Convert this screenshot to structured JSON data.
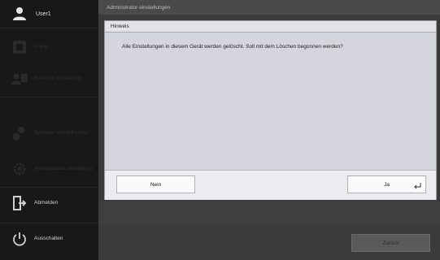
{
  "user": {
    "name": "User1",
    "icon": "user-icon"
  },
  "sidebar": {
    "items": [
      {
        "label": "Kopie",
        "icon": "copy-icon",
        "state": "disabled"
      },
      {
        "label": "Einfache Einstellung",
        "icon": "user-settings-icon",
        "state": "disabled"
      },
      {
        "label": "Benutzer-einstellungen",
        "icon": "user-gear-icon",
        "state": "disabled"
      },
      {
        "label": "Administrator einstellung",
        "icon": "gear-icon",
        "state": "disabled"
      },
      {
        "label": "Abmelden",
        "icon": "logout-icon",
        "state": "active"
      },
      {
        "label": "Ausschalten",
        "icon": "power-icon",
        "state": "active"
      }
    ]
  },
  "main": {
    "title": "Administrator einstellungen",
    "back_label": "Zurück"
  },
  "dialog": {
    "title": "Hinweis",
    "message": "Alle Einstellungen in diesem Gerät werden gelöscht. Soll mit dem Löschen begonnen werden?",
    "no_label": "Nein",
    "yes_label": "Ja",
    "yes_icon": "enter-icon"
  },
  "colors": {
    "sidebar_bg": "#181818",
    "main_bg": "#3b3b3b",
    "dialog_bg": "#d5d5dd",
    "button_bg": "#fafafa"
  }
}
